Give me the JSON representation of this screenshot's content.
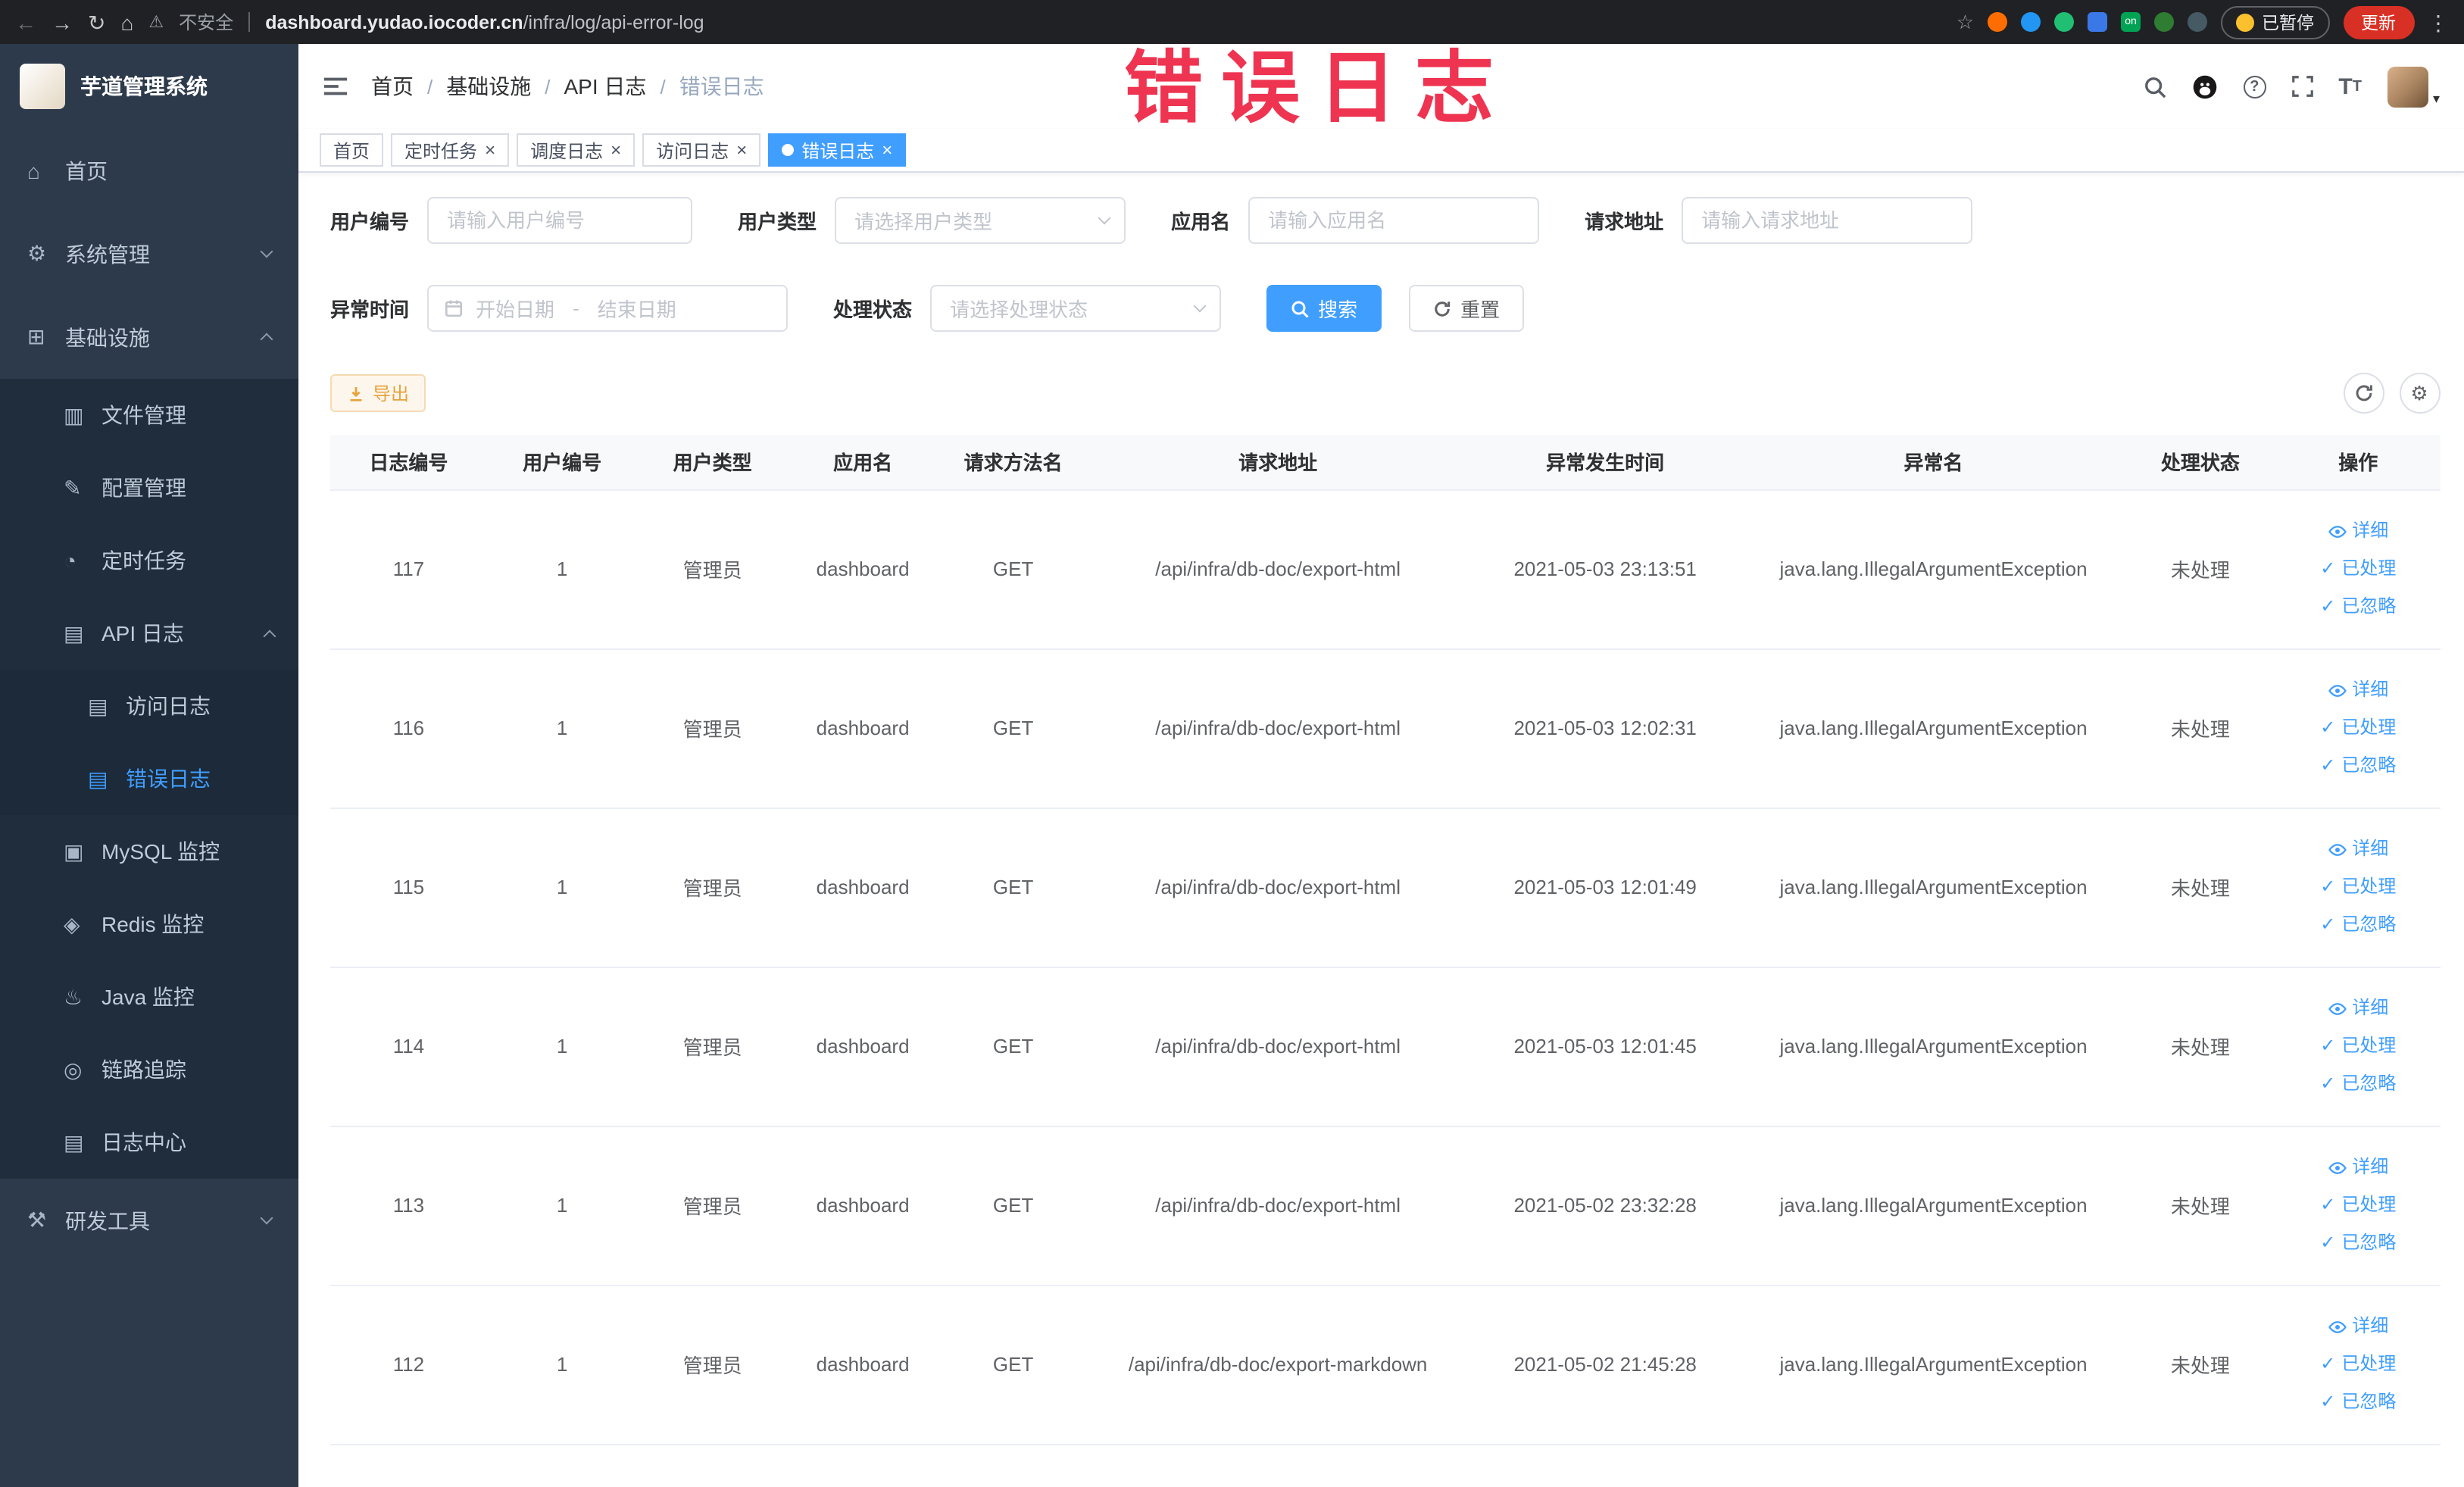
{
  "browser": {
    "security_label": "不安全",
    "url_host": "dashboard.yudao.iocoder.cn",
    "url_path": "/infra/log/api-error-log",
    "paused_badge": "已暂停",
    "update_button": "更新"
  },
  "annotation": {
    "text": "错误日志",
    "color": "#ee3450"
  },
  "sidebar": {
    "logo_title": "芋道管理系统",
    "items": [
      {
        "label": "首页",
        "level": 0,
        "icon": "home"
      },
      {
        "label": "系统管理",
        "level": 0,
        "icon": "gear",
        "chevron": "down"
      },
      {
        "label": "基础设施",
        "level": 0,
        "icon": "infrastructure",
        "chevron": "up"
      },
      {
        "label": "文件管理",
        "level": 1,
        "icon": "file"
      },
      {
        "label": "配置管理",
        "level": 1,
        "icon": "config"
      },
      {
        "label": "定时任务",
        "level": 1,
        "icon": "timer"
      },
      {
        "label": "API 日志",
        "level": 1,
        "icon": "api-log",
        "chevron": "up"
      },
      {
        "label": "访问日志",
        "level": 2,
        "icon": "access-log"
      },
      {
        "label": "错误日志",
        "level": 2,
        "icon": "error-log",
        "active": true
      },
      {
        "label": "MySQL 监控",
        "level": 1,
        "icon": "mysql"
      },
      {
        "label": "Redis 监控",
        "level": 1,
        "icon": "redis"
      },
      {
        "label": "Java 监控",
        "level": 1,
        "icon": "java"
      },
      {
        "label": "链路追踪",
        "level": 1,
        "icon": "trace"
      },
      {
        "label": "日志中心",
        "level": 1,
        "icon": "log-center"
      },
      {
        "label": "研发工具",
        "level": 0,
        "icon": "tools",
        "chevron": "down"
      }
    ]
  },
  "header": {
    "breadcrumb": [
      "首页",
      "基础设施",
      "API 日志",
      "错误日志"
    ]
  },
  "tabs": [
    {
      "label": "首页",
      "closable": false,
      "active": false
    },
    {
      "label": "定时任务",
      "closable": true,
      "active": false
    },
    {
      "label": "调度日志",
      "closable": true,
      "active": false
    },
    {
      "label": "访问日志",
      "closable": true,
      "active": false
    },
    {
      "label": "错误日志",
      "closable": true,
      "active": true
    }
  ],
  "filters": {
    "user_id": {
      "label": "用户编号",
      "placeholder": "请输入用户编号"
    },
    "user_type": {
      "label": "用户类型",
      "placeholder": "请选择用户类型"
    },
    "app_name": {
      "label": "应用名",
      "placeholder": "请输入应用名"
    },
    "request_url": {
      "label": "请求地址",
      "placeholder": "请输入请求地址"
    },
    "exception_time": {
      "label": "异常时间",
      "start_placeholder": "开始日期",
      "separator": "-",
      "end_placeholder": "结束日期"
    },
    "process_status": {
      "label": "处理状态",
      "placeholder": "请选择处理状态"
    },
    "search_button": "搜索",
    "reset_button": "重置"
  },
  "toolbar": {
    "export_button": "导出"
  },
  "table": {
    "columns": [
      "日志编号",
      "用户编号",
      "用户类型",
      "应用名",
      "请求方法名",
      "请求地址",
      "异常发生时间",
      "异常名",
      "处理状态",
      "操作"
    ],
    "row_actions": {
      "detail": "详细",
      "processed": "已处理",
      "ignored": "已忽略"
    },
    "rows": [
      {
        "id": "117",
        "user_id": "1",
        "user_type": "管理员",
        "app_name": "dashboard",
        "method": "GET",
        "url": "/api/infra/db-doc/export-html",
        "time": "2021-05-03 23:13:51",
        "exception": "java.lang.IllegalArgumentException",
        "status": "未处理"
      },
      {
        "id": "116",
        "user_id": "1",
        "user_type": "管理员",
        "app_name": "dashboard",
        "method": "GET",
        "url": "/api/infra/db-doc/export-html",
        "time": "2021-05-03 12:02:31",
        "exception": "java.lang.IllegalArgumentException",
        "status": "未处理"
      },
      {
        "id": "115",
        "user_id": "1",
        "user_type": "管理员",
        "app_name": "dashboard",
        "method": "GET",
        "url": "/api/infra/db-doc/export-html",
        "time": "2021-05-03 12:01:49",
        "exception": "java.lang.IllegalArgumentException",
        "status": "未处理"
      },
      {
        "id": "114",
        "user_id": "1",
        "user_type": "管理员",
        "app_name": "dashboard",
        "method": "GET",
        "url": "/api/infra/db-doc/export-html",
        "time": "2021-05-03 12:01:45",
        "exception": "java.lang.IllegalArgumentException",
        "status": "未处理"
      },
      {
        "id": "113",
        "user_id": "1",
        "user_type": "管理员",
        "app_name": "dashboard",
        "method": "GET",
        "url": "/api/infra/db-doc/export-html",
        "time": "2021-05-02 23:32:28",
        "exception": "java.lang.IllegalArgumentException",
        "status": "未处理"
      },
      {
        "id": "112",
        "user_id": "1",
        "user_type": "管理员",
        "app_name": "dashboard",
        "method": "GET",
        "url": "/api/infra/db-doc/export-markdown",
        "time": "2021-05-02 21:45:28",
        "exception": "java.lang.IllegalArgumentException",
        "status": "未处理"
      }
    ]
  }
}
